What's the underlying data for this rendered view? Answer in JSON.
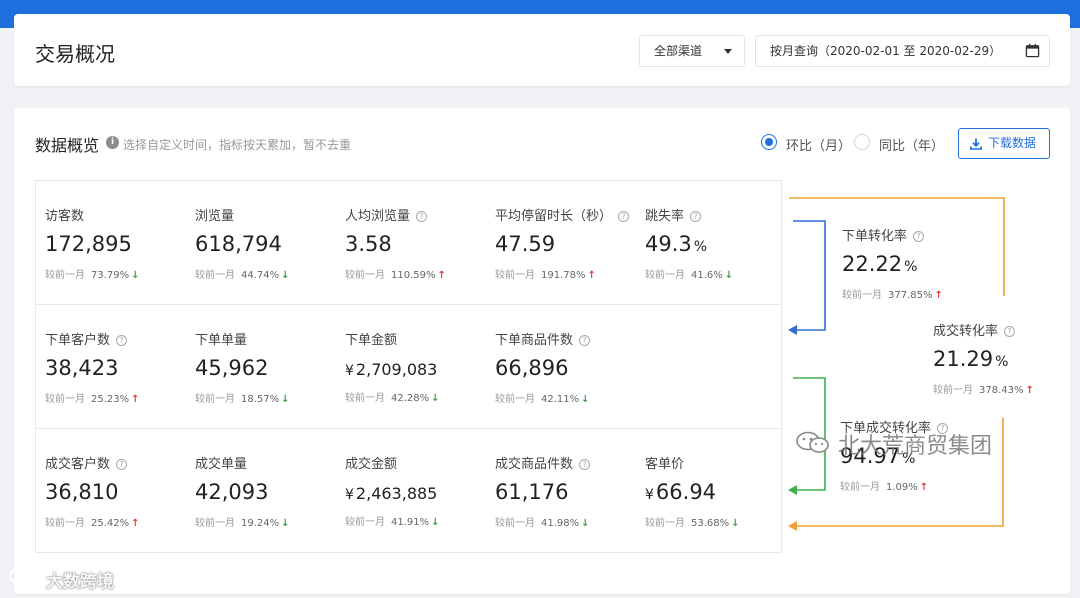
{
  "header": {
    "title": "交易概况",
    "channel_select": "全部渠道",
    "date_range": "按月查询（2020-02-01 至 2020-02-29）"
  },
  "overview": {
    "title": "数据概览",
    "hint": "选择自定义时间，指标按天累加，暂不去重",
    "radio_mom": "环比（月）",
    "radio_yoy": "同比（年）",
    "radio_selected": "mom",
    "download_label": "下载数据",
    "compare_label": "较前一月"
  },
  "metrics": {
    "visitors": {
      "label": "访客数",
      "value": "172,895",
      "pct": "73.79%",
      "dir": "down"
    },
    "pageviews": {
      "label": "浏览量",
      "value": "618,794",
      "pct": "44.74%",
      "dir": "down"
    },
    "pv_per_visitor": {
      "label": "人均浏览量",
      "value": "3.58",
      "pct": "110.59%",
      "dir": "up"
    },
    "avg_stay": {
      "label": "平均停留时长（秒）",
      "value": "47.59",
      "pct": "191.78%",
      "dir": "up"
    },
    "bounce_rate": {
      "label": "跳失率",
      "value": "49.3",
      "unit": "%",
      "pct": "41.6%",
      "dir": "down"
    },
    "order_customers": {
      "label": "下单客户数",
      "value": "38,423",
      "pct": "25.23%",
      "dir": "up"
    },
    "order_count": {
      "label": "下单单量",
      "value": "45,962",
      "pct": "18.57%",
      "dir": "down"
    },
    "order_amount": {
      "label": "下单金额",
      "value": "2,709,083",
      "currency": "¥",
      "pct": "42.28%",
      "dir": "down"
    },
    "order_items": {
      "label": "下单商品件数",
      "value": "66,896",
      "pct": "42.11%",
      "dir": "down"
    },
    "deal_customers": {
      "label": "成交客户数",
      "value": "36,810",
      "pct": "25.42%",
      "dir": "up"
    },
    "deal_count": {
      "label": "成交单量",
      "value": "42,093",
      "pct": "19.24%",
      "dir": "down"
    },
    "deal_amount": {
      "label": "成交金额",
      "value": "2,463,885",
      "currency": "¥",
      "pct": "41.91%",
      "dir": "down"
    },
    "deal_items": {
      "label": "成交商品件数",
      "value": "61,176",
      "pct": "41.98%",
      "dir": "down"
    },
    "avg_order_value": {
      "label": "客单价",
      "value": "66.94",
      "currency": "¥",
      "pct": "53.68%",
      "dir": "down"
    }
  },
  "funnel": {
    "order_conversion": {
      "label": "下单转化率",
      "value": "22.22",
      "unit": "%",
      "pct": "377.85%",
      "dir": "up"
    },
    "deal_conversion": {
      "label": "成交转化率",
      "value": "21.29",
      "unit": "%",
      "pct": "378.43%",
      "dir": "up"
    },
    "order_deal_conversion": {
      "label": "下单成交转化率",
      "value": "94.97",
      "unit": "%",
      "pct": "1.09%",
      "dir": "up"
    },
    "colors": {
      "blue": "#2f6fd6",
      "green": "#3fb04a",
      "orange": "#f0a030"
    }
  },
  "watermarks": {
    "right": "北大荒商贸集团",
    "left": "大数跨境"
  },
  "colors": {
    "accent": "#1f6fde",
    "up": "#e53935",
    "down": "#43a047"
  }
}
